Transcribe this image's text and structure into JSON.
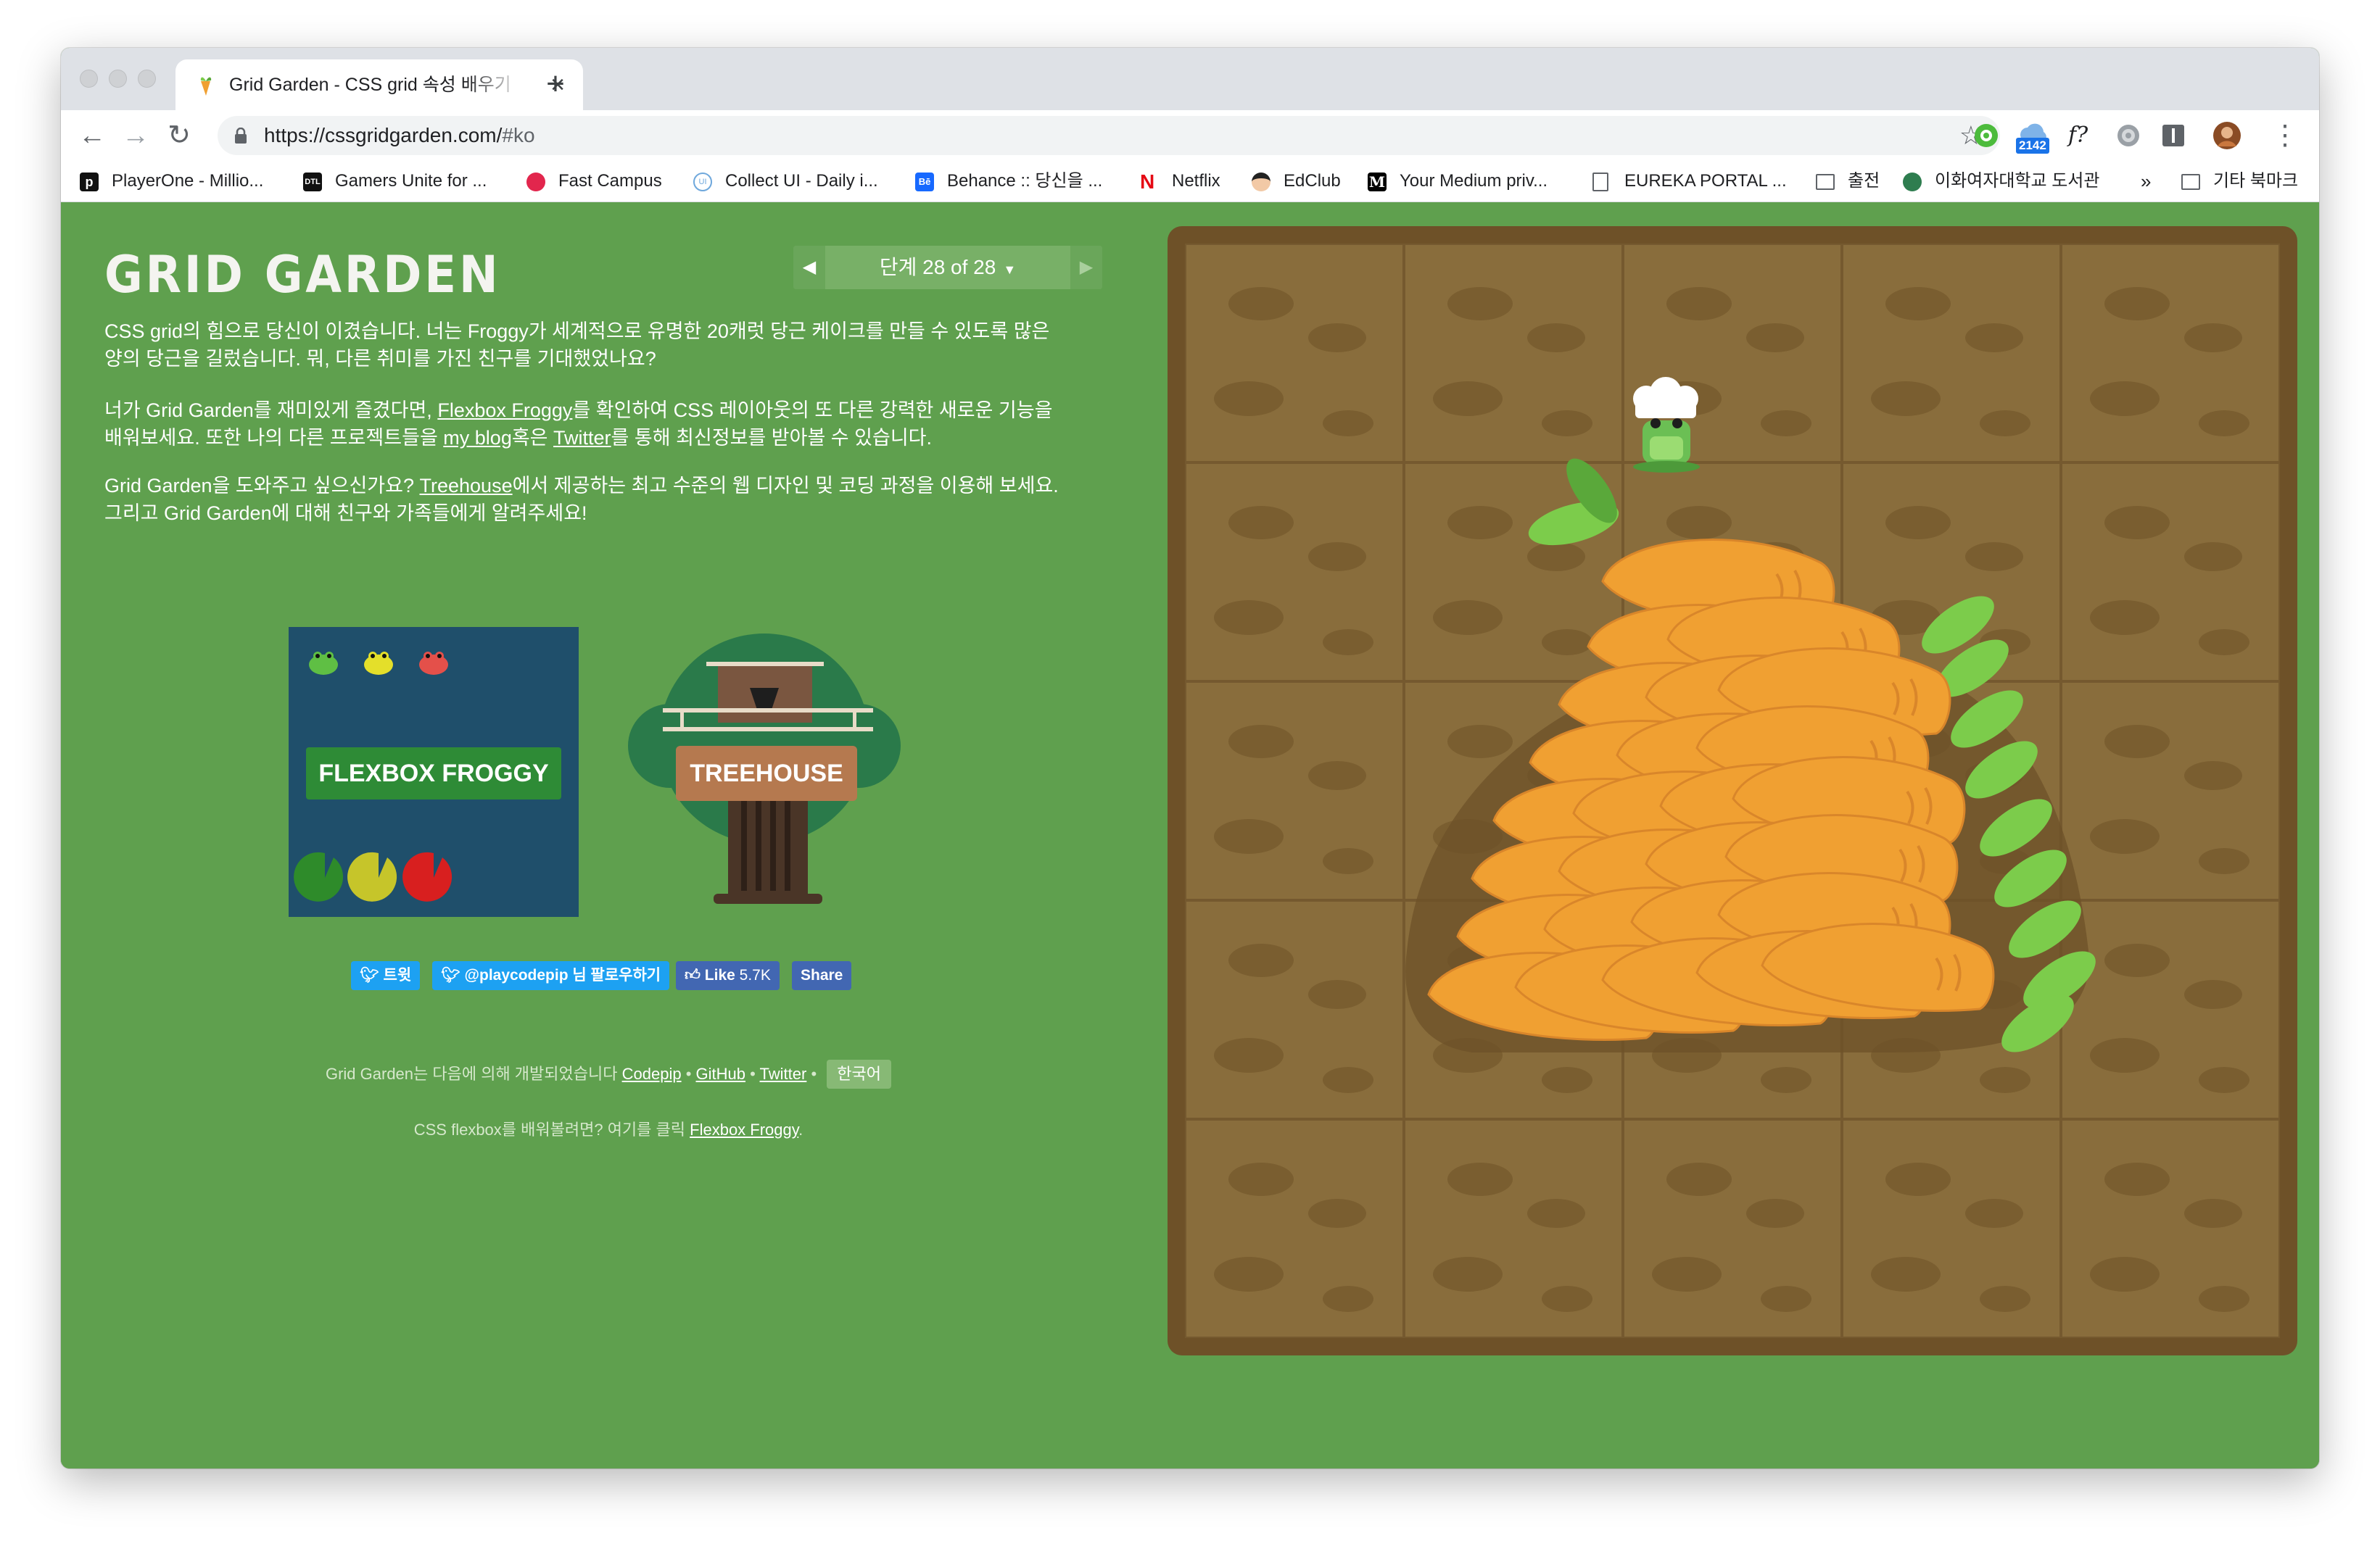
{
  "browser": {
    "tab": {
      "title": "Grid Garden - CSS grid 속성 배우기",
      "close_icon": "close-icon",
      "new_tab_icon": "plus-icon"
    },
    "toolbar": {
      "back_icon": "arrow-left-icon",
      "forward_icon": "arrow-right-icon",
      "reload_icon": "reload-icon",
      "url_main": "https://cssgridgarden.com/",
      "url_hash": "#ko",
      "bookmark_star_icon": "star-icon",
      "extension_badge": "2142",
      "extension_fx": "f?",
      "menu_icon": "kebab-menu-icon"
    },
    "bookmarks": [
      {
        "label": "PlayerOne - Millio...",
        "color": "#111111",
        "glyph": "p"
      },
      {
        "label": "Gamers Unite for ...",
        "color": "#111111",
        "glyph": "DTL"
      },
      {
        "label": "Fast Campus",
        "color": "#e2264d",
        "glyph": "●"
      },
      {
        "label": "Collect UI - Daily i...",
        "color": "#6fa8dc",
        "glyph": "UI"
      },
      {
        "label": "Behance :: 당신을 ...",
        "color": "#1769ff",
        "glyph": "Bē"
      },
      {
        "label": "Netflix",
        "color": "#e50914",
        "glyph": "N"
      },
      {
        "label": "EdClub",
        "color": "#333333",
        "glyph": "●"
      },
      {
        "label": "Your Medium priv...",
        "color": "#000000",
        "glyph": "M"
      },
      {
        "label": "EUREKA PORTAL ...",
        "color": "#ffffff",
        "glyph": "▯"
      },
      {
        "label": "출전",
        "color": "#ffffff",
        "glyph": "▭"
      },
      {
        "label": "이화여자대학교 도서관",
        "color": "#2e7d4f",
        "glyph": "✿"
      }
    ],
    "bookmarks_overflow": "»",
    "bookmarks_other": "기타 북마크"
  },
  "page": {
    "title": "GRID GARDEN",
    "level": {
      "label": "단계 28 of 28",
      "prev_icon": "triangle-left-icon",
      "next_icon": "triangle-right-icon"
    },
    "para1": {
      "line1": "CSS grid의 힘으로 당신이 이겼습니다. 너는 Froggy가 세계적으로 유명한 20캐럿 당근 케이크를 만들 수 있도록 많은",
      "line2": "양의 당근을 길렀습니다. 뭐, 다른 취미를 가진 친구를 기대했었나요?"
    },
    "para2": {
      "t1": "너가 Grid Garden를 재미있게 즐겼다면, ",
      "link1": "Flexbox Froggy",
      "t2": "를 확인하여 CSS 레이아웃의 또 다른 강력한 새로운 기능을",
      "t3": "배워보세요. 또한 나의 다른 프로젝트들을 ",
      "link2": "my blog",
      "t4": "혹은 ",
      "link3": "Twitter",
      "t5": "를 통해 최신정보를 받아볼 수 있습니다."
    },
    "para3": {
      "t1": "Grid Garden을 도와주고 싶으신가요? ",
      "link1": "Treehouse",
      "t2": "에서 제공하는 최고 수준의 웹 디자인 및 코딩 과정을 이용해 보세요.",
      "t3": "그리고 Grid Garden에 대해 친구와 가족들에게 알려주세요!"
    },
    "promo_froggy": "FLEXBOX FROGGY",
    "promo_treehouse": "TREEHOUSE",
    "social": {
      "tweet": "트윗",
      "follow": "@playcodepip 님 팔로우하기",
      "like": "Like",
      "like_count": "5.7K",
      "share": "Share"
    },
    "footer": {
      "made_by": "Grid Garden는 다음에 의해 개발되었습니다",
      "codepip": "Codepip",
      "github": "GitHub",
      "twitter": "Twitter",
      "sep": "•",
      "language": "한국어",
      "flexbox_prompt": "CSS flexbox를 배워볼려면? 여기를 클릭",
      "flexbox_link": "Flexbox Froggy",
      "period": "."
    },
    "garden_accessory": "chef-hat-icon"
  },
  "colors": {
    "page_bg": "#5fa04e",
    "soil": "#896d3c",
    "soil_border": "#6e5128",
    "carrot": "#f0a032",
    "leaf": "#7ccc4b",
    "frog": "#6bbf54",
    "tweet_blue": "#1da1f2",
    "facebook_blue": "#4267b2",
    "froggy_panel": "#1f4f6b",
    "treehouse_sign": "#b5794f"
  }
}
